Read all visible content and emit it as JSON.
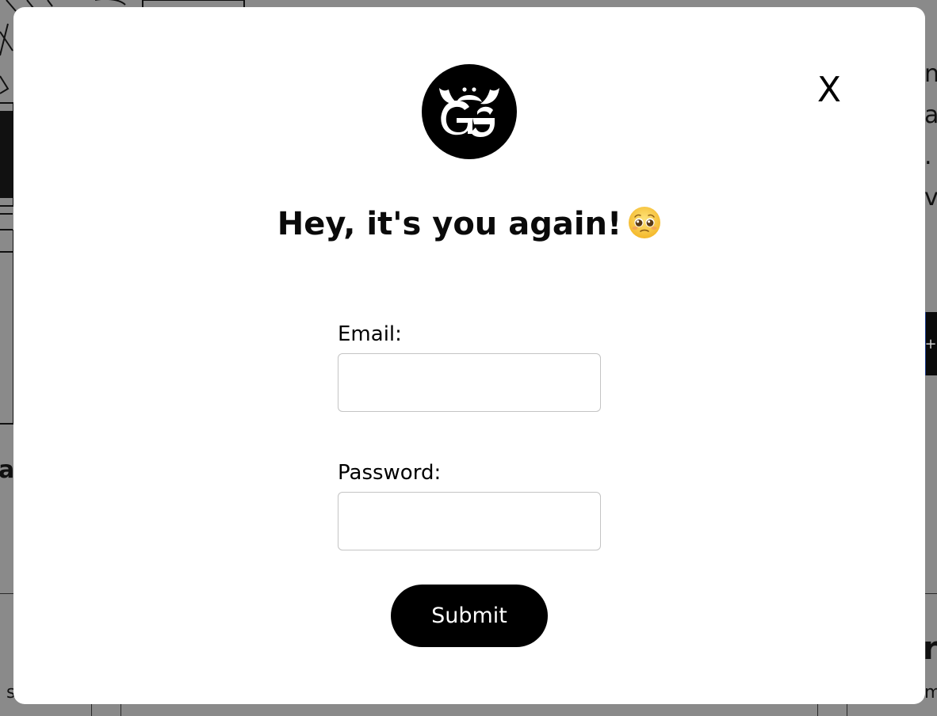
{
  "background": {
    "left_partial_text": "at",
    "bottom_left_text": "s",
    "right_partial_letters": [
      "na",
      "a",
      ".",
      "v"
    ],
    "right_button_symbol": "+",
    "right_heading_partial": "rk",
    "bottom_right_text": "m"
  },
  "modal": {
    "logo_icon": "gg-bull-logo-icon",
    "close_label": "X",
    "heading": "Hey, it's you again!",
    "heading_emoji": "pleading-face-icon",
    "email_label": "Email:",
    "email_value": "",
    "password_label": "Password:",
    "password_value": "",
    "submit_label": "Submit"
  },
  "colors": {
    "overlay": "#8a8a8a",
    "modal_bg": "#ffffff",
    "primary_button": "#000000",
    "input_border": "#c4c4c4",
    "emoji_yellow": "#f7c531"
  }
}
